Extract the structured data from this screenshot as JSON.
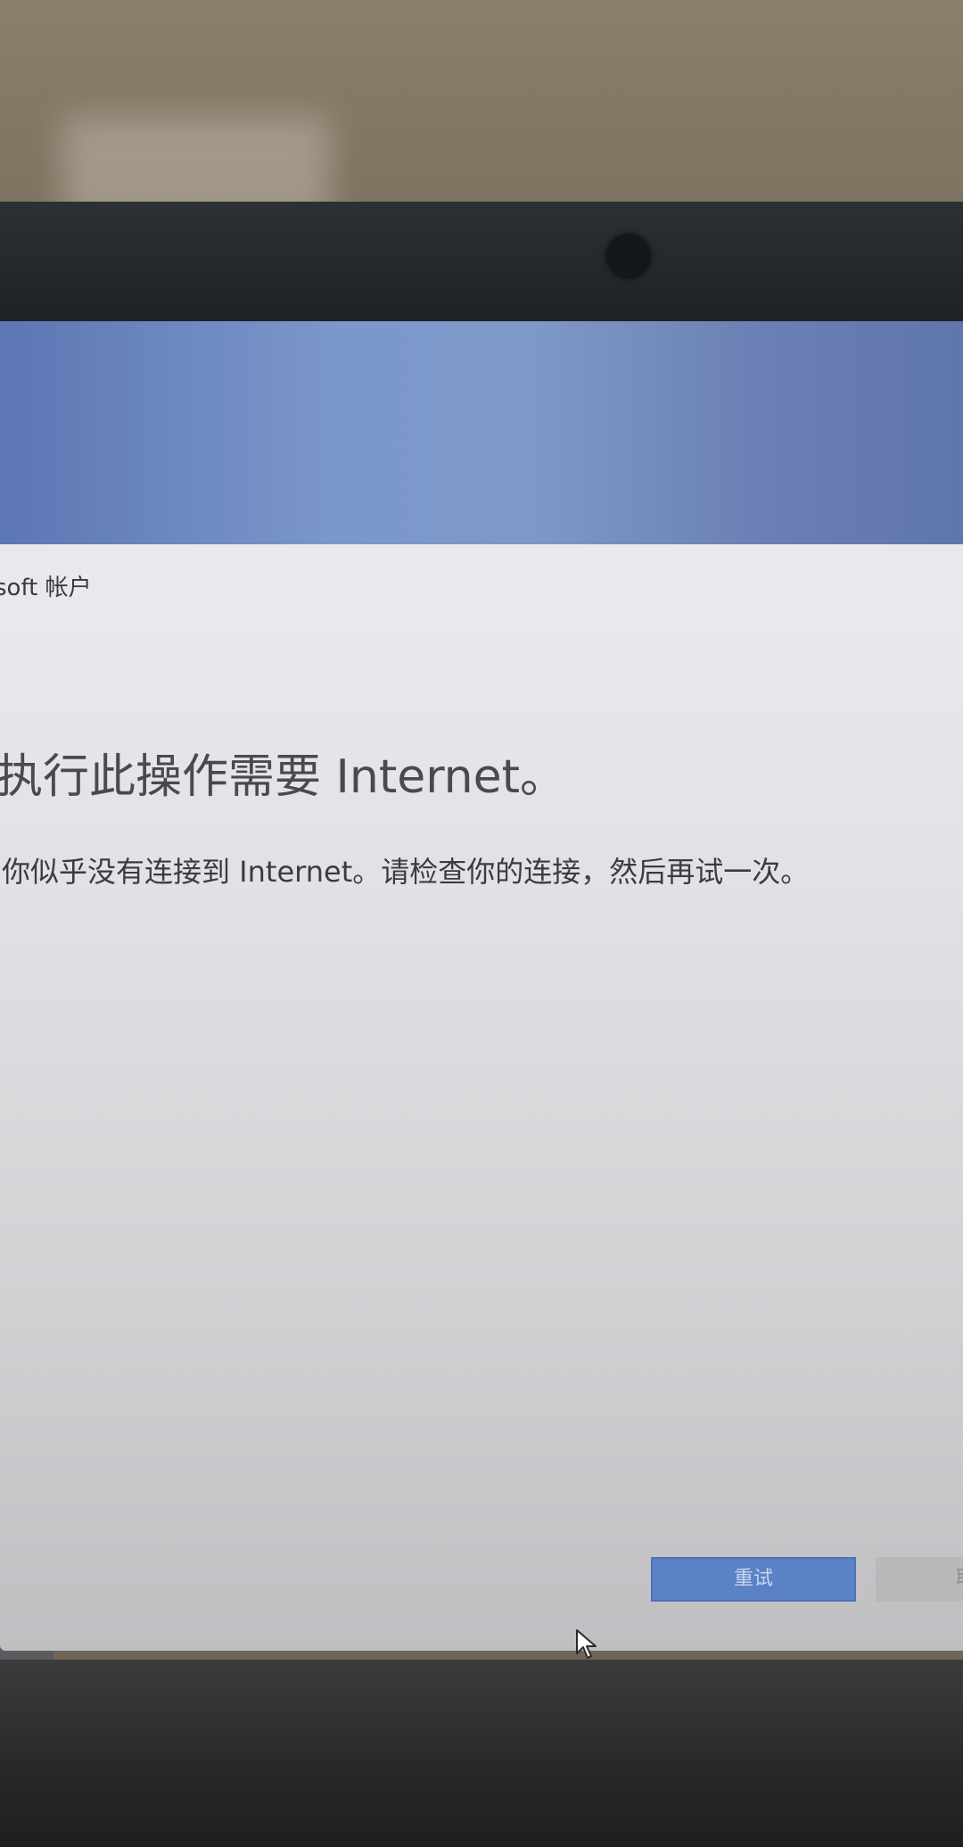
{
  "dialog": {
    "title": "soft 帐户",
    "heading": "执行此操作需要 Internet。",
    "message": "你似乎没有连接到 Internet。请检查你的连接，然后再试一次。",
    "retry_label": "重试",
    "cancel_label": "取"
  },
  "colors": {
    "primary_button": "#5b82c6",
    "desktop_blue": "#7c97cb"
  },
  "icons": {
    "cursor": "mouse-pointer-icon",
    "webcam": "webcam-icon"
  }
}
